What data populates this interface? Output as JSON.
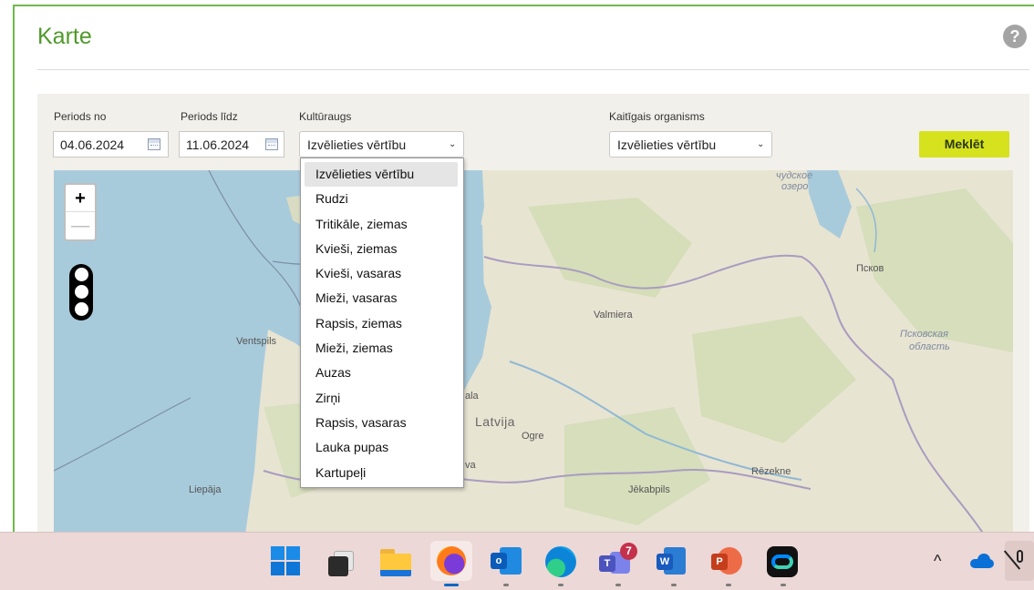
{
  "page": {
    "title": "Karte",
    "help_glyph": "?"
  },
  "filters": {
    "period_from": {
      "label": "Periods no",
      "value": "04.06.2024"
    },
    "period_to": {
      "label": "Periods līdz",
      "value": "11.06.2024"
    },
    "crop": {
      "label": "Kultūraugs",
      "selected": "Izvēlieties vērtību",
      "options": [
        "Izvēlieties vērtību",
        "Rudzi",
        "Tritikāle, ziemas",
        "Kvieši, ziemas",
        "Kvieši, vasaras",
        "Mieži, vasaras",
        "Rapsis, ziemas",
        "Mieži, ziemas",
        "Auzas",
        "Zirņi",
        "Rapsis, vasaras",
        "Lauka pupas",
        "Kartupeļi"
      ]
    },
    "pest": {
      "label": "Kaitīgais organisms",
      "selected": "Izvēlieties vērtību"
    },
    "search_button": "Meklēt"
  },
  "map": {
    "zoom_in": "+",
    "zoom_out": "—",
    "places": {
      "ventspils": "Ventspils",
      "valmiera": "Valmiera",
      "latvija": "Latvija",
      "ogre": "Ogre",
      "rezekne": "Rēzekne",
      "jekabpils": "Jēkabpils",
      "liepaja": "Liepāja",
      "pskov": "Псков",
      "pskov_oblast_1": "Псковская",
      "pskov_oblast_2": "область",
      "lake_1": "чудское",
      "lake_2": "озеро",
      "riga_part": "ala",
      "va_part": "va"
    },
    "colors": {
      "sea": "#a8cbdc",
      "land": "#e8e4d2",
      "forest": "#cfdcb2"
    }
  },
  "taskbar": {
    "apps": [
      "windows-start",
      "task-view",
      "file-explorer",
      "firefox",
      "outlook",
      "edge",
      "teams",
      "word",
      "powerpoint",
      "webex"
    ],
    "teams_badge": "7",
    "tray_chevron": "^"
  }
}
